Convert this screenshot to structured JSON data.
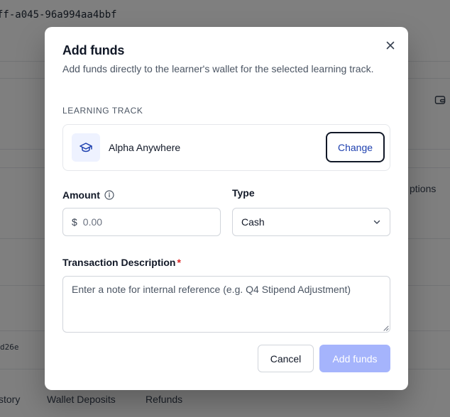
{
  "background": {
    "id_text": "ff-a045-96a994aa4bbf",
    "side_text": "ptions",
    "short_id": "d26e",
    "tabs": [
      "story",
      "Wallet Deposits",
      "Refunds"
    ]
  },
  "modal": {
    "title": "Add funds",
    "description": "Add funds directly to the learner's wallet for the selected learning track.",
    "close_icon": "close-icon",
    "section_label": "LEARNING TRACK",
    "track": {
      "icon": "graduation-cap-icon",
      "name": "Alpha Anywhere",
      "change_label": "Change"
    },
    "amount": {
      "label": "Amount",
      "info_icon": "info-icon",
      "currency_symbol": "$",
      "placeholder": "0.00",
      "value": ""
    },
    "type": {
      "label": "Type",
      "selected": "Cash",
      "chevron_icon": "chevron-down-icon"
    },
    "transaction_description": {
      "label": "Transaction Description",
      "required_mark": "*",
      "placeholder": "Enter a note for internal reference (e.g. Q4 Stipend Adjustment)",
      "value": ""
    },
    "buttons": {
      "cancel": "Cancel",
      "submit": "Add funds"
    }
  },
  "colors": {
    "accent": "#1e40af",
    "submit_disabled": "#a5b4fc",
    "required": "#dc2626",
    "icon_bg": "#eef2ff"
  }
}
